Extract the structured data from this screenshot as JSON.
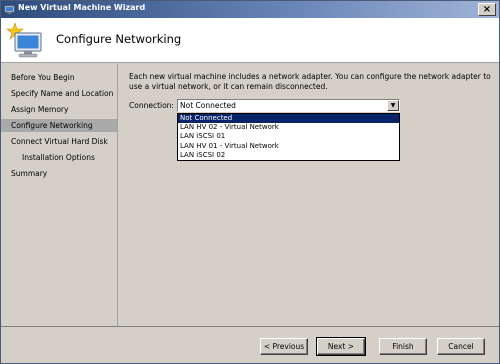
{
  "window": {
    "title": "New Virtual Machine Wizard",
    "close_label": "×"
  },
  "header": {
    "title": "Configure Networking"
  },
  "sidebar": {
    "items": [
      {
        "label": "Before You Begin"
      },
      {
        "label": "Specify Name and Location"
      },
      {
        "label": "Assign Memory"
      },
      {
        "label": "Configure Networking"
      },
      {
        "label": "Connect Virtual Hard Disk"
      },
      {
        "label": "Installation Options"
      },
      {
        "label": "Summary"
      }
    ]
  },
  "content": {
    "description": "Each new virtual machine includes a network adapter. You can configure the network adapter to use a virtual network, or it can remain disconnected.",
    "connection_label": "Connection:",
    "connection_value": "Not Connected",
    "options": [
      {
        "label": "Not Connected"
      },
      {
        "label": "LAN HV 02 - Virtual Network"
      },
      {
        "label": "LAN iSCSI 01"
      },
      {
        "label": "LAN HV 01 - Virtual Network"
      },
      {
        "label": "LAN iSCSI 02"
      }
    ]
  },
  "footer": {
    "previous_label": "< Previous",
    "next_label": "Next >",
    "finish_label": "Finish",
    "cancel_label": "Cancel"
  }
}
